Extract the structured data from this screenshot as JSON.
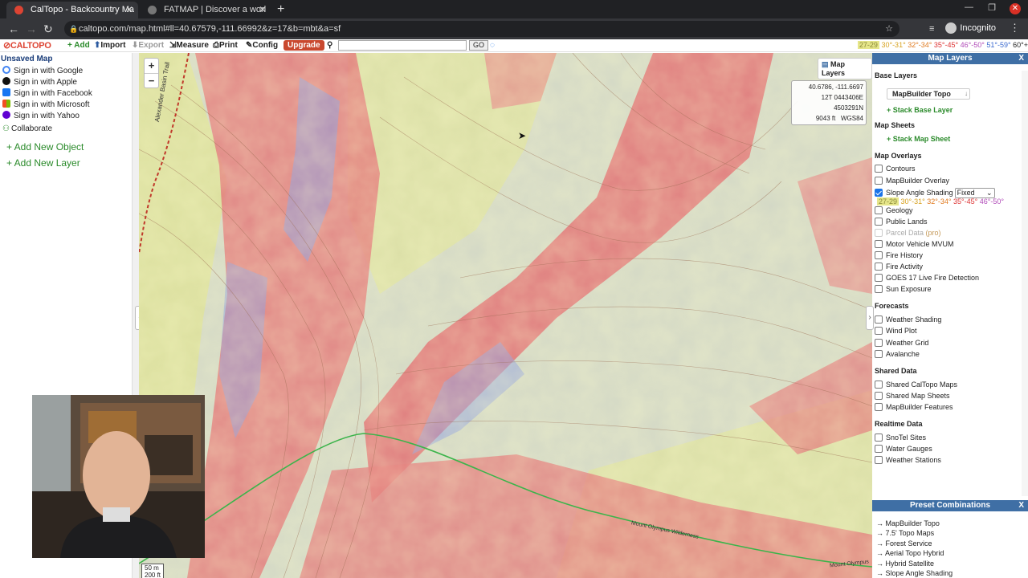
{
  "browser": {
    "tabs": [
      {
        "title": "CalTopo - Backcountry Ma",
        "active": true
      },
      {
        "title": "FATMAP | Discover a worl",
        "active": false
      }
    ],
    "url": "caltopo.com/map.html#ll=40.67579,-111.66992&z=17&b=mbt&a=sf",
    "profile": "Incognito"
  },
  "toolbar": {
    "logo": "CALTOPO",
    "add": "+ Add",
    "import": "Import",
    "export": "Export",
    "measure": "Measure",
    "print": "Print",
    "config": "Config",
    "upgrade": "Upgrade",
    "go": "GO",
    "legend": [
      "27-29",
      "30°-31°",
      "32°-34°",
      "35°-45°",
      "46°-50°",
      "51°-59°",
      "60°+"
    ]
  },
  "left_panel": {
    "title": "Unsaved Map",
    "signin": [
      {
        "label": "Sign in with Google",
        "icon": "google-icon",
        "color": "#4285f4"
      },
      {
        "label": "Sign in with Apple",
        "icon": "apple-icon",
        "color": "#111111"
      },
      {
        "label": "Sign in with Facebook",
        "icon": "facebook-icon",
        "color": "#1877f2"
      },
      {
        "label": "Sign in with Microsoft",
        "icon": "microsoft-icon",
        "color": "#f25022"
      },
      {
        "label": "Sign in with Yahoo",
        "icon": "yahoo-icon",
        "color": "#6001d2"
      }
    ],
    "collaborate": "Collaborate",
    "add_object": "+ Add New Object",
    "add_layer": "+ Add New Layer"
  },
  "map": {
    "coords": {
      "latlon": "40.6786, -111.6697",
      "utm": "12T 0443406E 4503291N",
      "elevation": "9043 ft",
      "datum": "WGS84"
    },
    "layers_button": "Map Layers",
    "scale": [
      "50 m",
      "200 ft"
    ],
    "labels": [
      "Alexander Basin Trail",
      "Mount Olympus Wilderness",
      "Mount Olympus"
    ]
  },
  "right_panel": {
    "title": "Map Layers",
    "base_layers": {
      "heading": "Base Layers",
      "selected": "MapBuilder Topo",
      "stack": "+ Stack Base Layer"
    },
    "map_sheets": {
      "heading": "Map Sheets",
      "stack": "+ Stack Map Sheet"
    },
    "overlays": {
      "heading": "Map Overlays",
      "items": [
        {
          "label": "Contours",
          "checked": false
        },
        {
          "label": "MapBuilder Overlay",
          "checked": false
        },
        {
          "label": "Slope Angle Shading",
          "checked": true,
          "mode": "Fixed"
        },
        {
          "label": "Geology",
          "checked": false
        },
        {
          "label": "Public Lands",
          "checked": false
        },
        {
          "label": "Parcel Data",
          "pro": "(pro)",
          "checked": false,
          "disabled": true
        },
        {
          "label": "Motor Vehicle MVUM",
          "checked": false
        },
        {
          "label": "Fire History",
          "checked": false
        },
        {
          "label": "Fire Activity",
          "checked": false
        },
        {
          "label": "GOES 17 Live Fire Detection",
          "checked": false
        },
        {
          "label": "Sun Exposure",
          "checked": false
        }
      ],
      "slope_legend": [
        "27-29",
        "30°-31°",
        "32°-34°",
        "35°-45°",
        "46°-50°"
      ]
    },
    "forecasts": {
      "heading": "Forecasts",
      "items": [
        "Weather Shading",
        "Wind Plot",
        "Weather Grid",
        "Avalanche"
      ]
    },
    "shared": {
      "heading": "Shared Data",
      "items": [
        "Shared CalTopo Maps",
        "Shared Map Sheets",
        "MapBuilder Features"
      ]
    },
    "realtime": {
      "heading": "Realtime Data",
      "items": [
        "SnoTel Sites",
        "Water Gauges",
        "Weather Stations"
      ]
    },
    "presets": {
      "title": "Preset Combinations",
      "items": [
        "MapBuilder Topo",
        "7.5' Topo Maps",
        "Forest Service",
        "Aerial Topo Hybrid",
        "Hybrid Satellite",
        "Slope Angle Shading"
      ]
    }
  }
}
